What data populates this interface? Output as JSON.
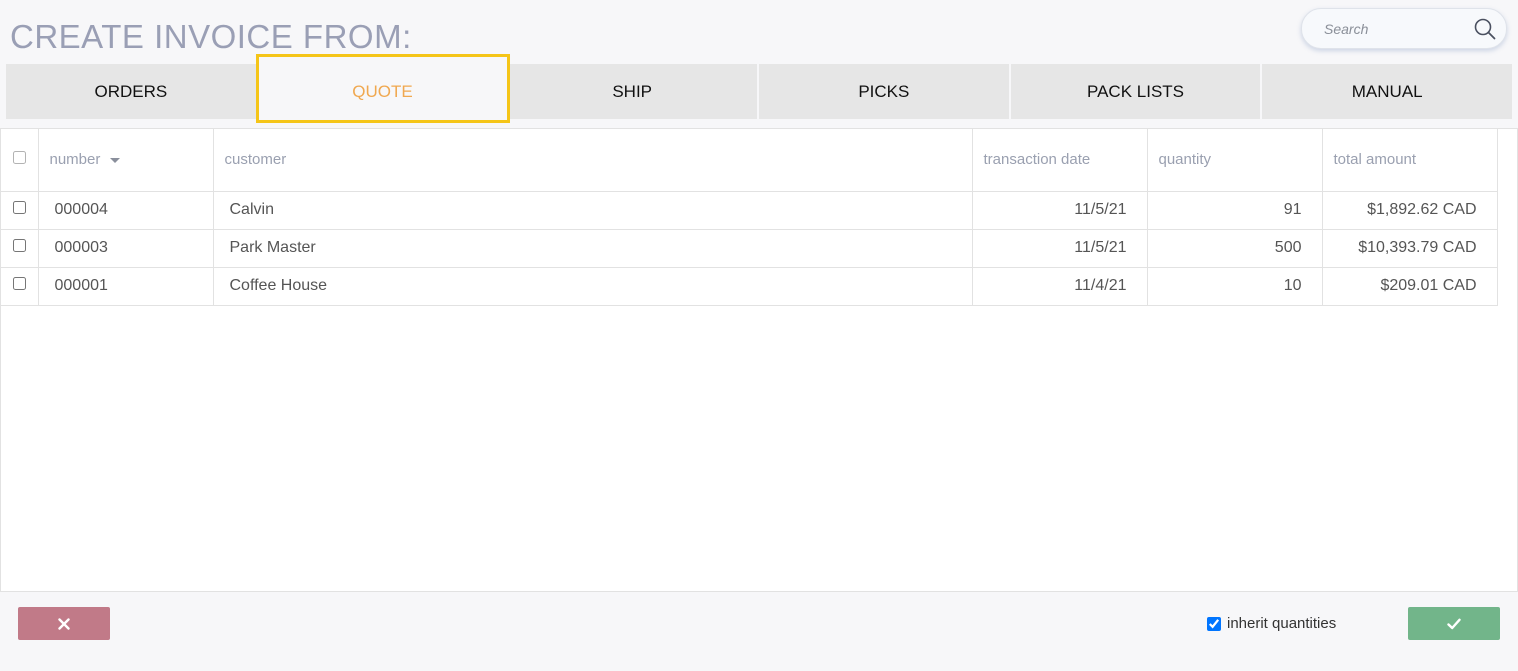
{
  "header": {
    "title": "CREATE INVOICE FROM:",
    "search_placeholder": "Search"
  },
  "tabs": [
    {
      "label": "ORDERS",
      "active": false
    },
    {
      "label": "QUOTE",
      "active": true
    },
    {
      "label": "SHIP",
      "active": false
    },
    {
      "label": "PICKS",
      "active": false
    },
    {
      "label": "PACK LISTS",
      "active": false
    },
    {
      "label": "MANUAL",
      "active": false
    }
  ],
  "table": {
    "columns": [
      "number",
      "customer",
      "transaction date",
      "quantity",
      "total amount"
    ],
    "sorted_column": "number",
    "rows": [
      {
        "number": "000004",
        "customer": "Calvin",
        "transaction_date": "11/5/21",
        "quantity": "91",
        "total_amount": "$1,892.62 CAD"
      },
      {
        "number": "000003",
        "customer": "Park Master",
        "transaction_date": "11/5/21",
        "quantity": "500",
        "total_amount": "$10,393.79 CAD"
      },
      {
        "number": "000001",
        "customer": "Coffee House",
        "transaction_date": "11/4/21",
        "quantity": "10",
        "total_amount": "$209.01 CAD"
      }
    ]
  },
  "footer": {
    "cancel_icon": "close-icon",
    "confirm_icon": "check-icon",
    "inherit_label": "inherit quantities",
    "inherit_checked": true
  },
  "colors": {
    "active_tab_text": "#f0a850",
    "highlight_border": "#f5c518",
    "cancel_bg": "#c17a88",
    "confirm_bg": "#72b58a",
    "title_color": "#9a9fb5"
  }
}
